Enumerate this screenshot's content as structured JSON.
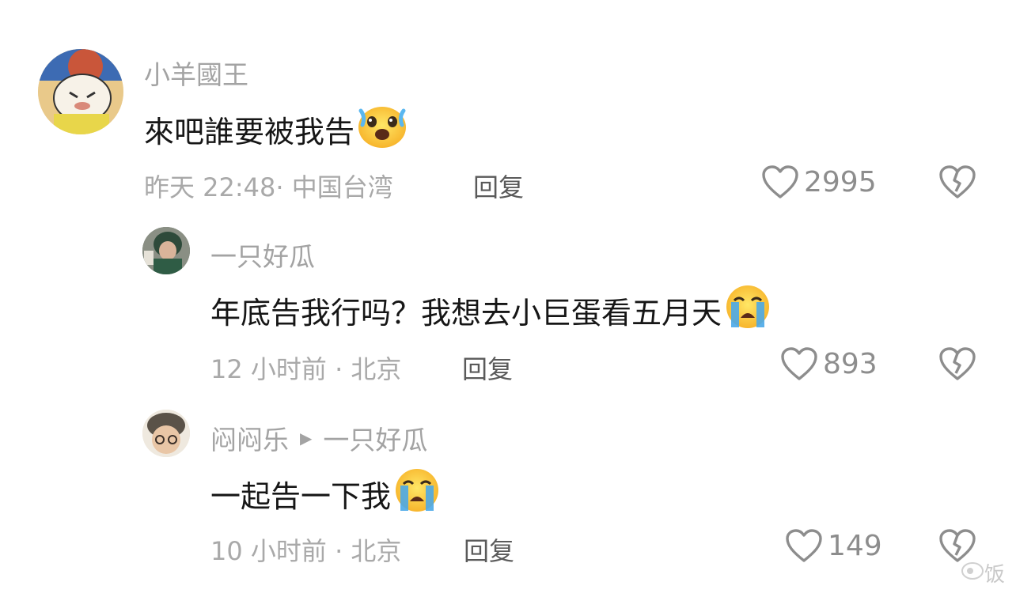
{
  "comments": [
    {
      "username": "小羊國王",
      "text": "來吧誰要被我告",
      "time_location": "昨天 22:48· 中国台湾",
      "reply_label": "回复",
      "likes": "2995",
      "emoji": "cold-sweat-emoji"
    },
    {
      "username": "一只好瓜",
      "text": "年底告我行吗？我想去小巨蛋看五月天",
      "time_location": "12 小时前 · 北京",
      "reply_label": "回复",
      "likes": "893",
      "emoji": "crying-emoji"
    },
    {
      "username": "闷闷乐",
      "reply_to": "一只好瓜",
      "text": "一起告一下我",
      "time_location": "10 小时前 · 北京",
      "reply_label": "回复",
      "likes": "149",
      "emoji": "crying-emoji"
    }
  ],
  "watermark": "饭",
  "colors": {
    "username": "#a3a3a3",
    "text": "#161616",
    "meta": "#a9a9a9",
    "reply": "#5a5a5a",
    "icon": "#8d8d8d"
  }
}
